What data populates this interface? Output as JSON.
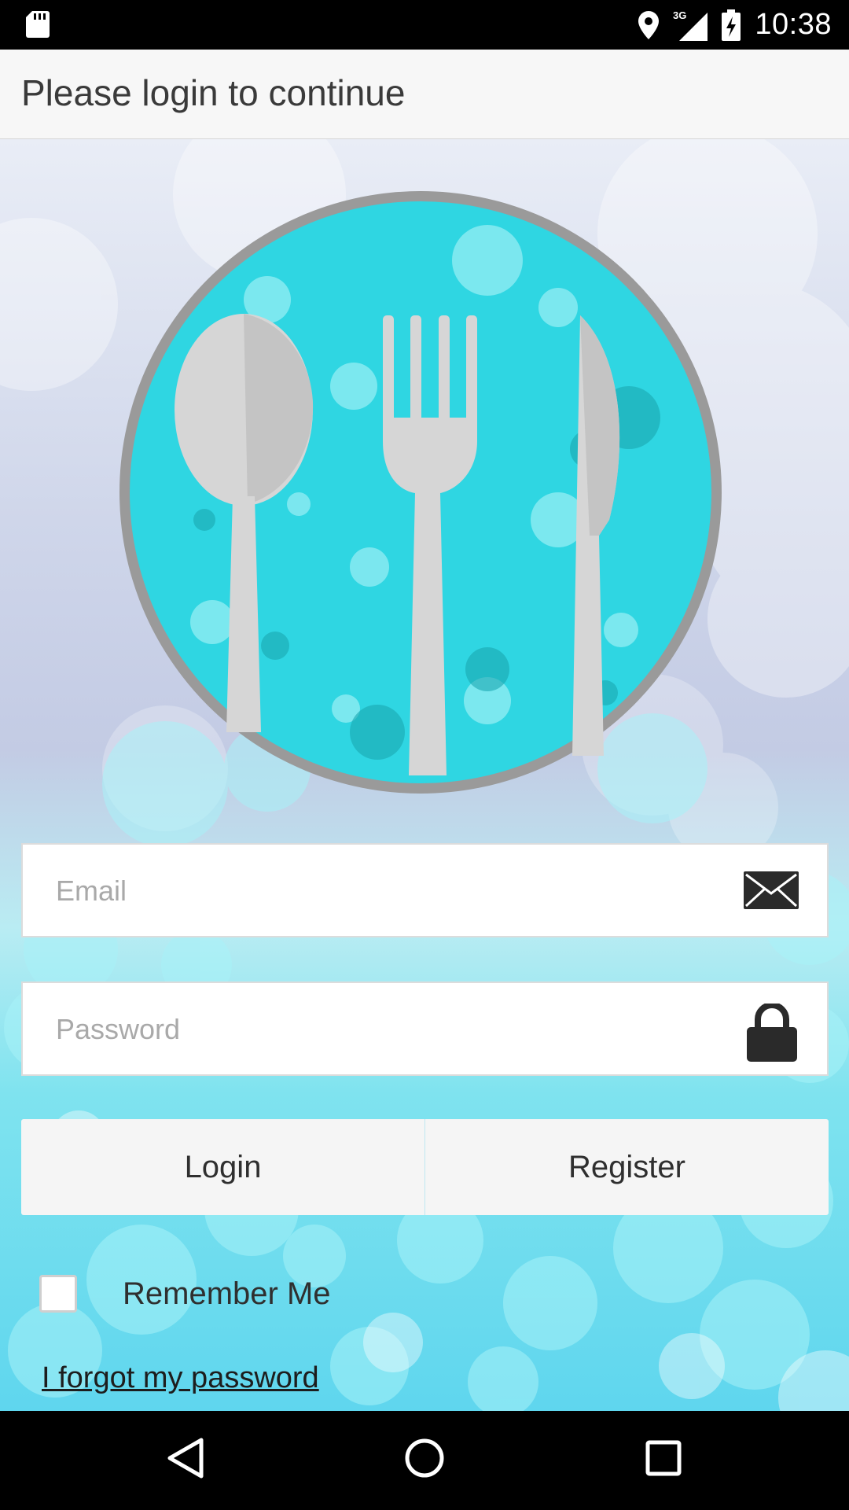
{
  "status_bar": {
    "time": "10:38",
    "network": "3G",
    "icons": [
      "sd-card-icon",
      "location-icon",
      "signal-3g-icon",
      "battery-charging-icon"
    ]
  },
  "app_bar": {
    "title": "Please login to continue"
  },
  "logo": {
    "icon": "cutlery-logo-icon",
    "colors": {
      "ring": "#9a9a9a",
      "fill": "#2fd6e2",
      "utensils": "#d7d7d7"
    }
  },
  "form": {
    "email": {
      "placeholder": "Email",
      "value": "",
      "icon": "envelope-icon"
    },
    "password": {
      "placeholder": "Password",
      "value": "",
      "icon": "lock-icon"
    },
    "login_label": "Login",
    "register_label": "Register",
    "remember_me_label": "Remember Me",
    "remember_me_checked": false,
    "forgot_password_label": "I forgot my password"
  },
  "nav_bar": {
    "icons": [
      "back-icon",
      "home-icon",
      "recents-icon"
    ]
  }
}
